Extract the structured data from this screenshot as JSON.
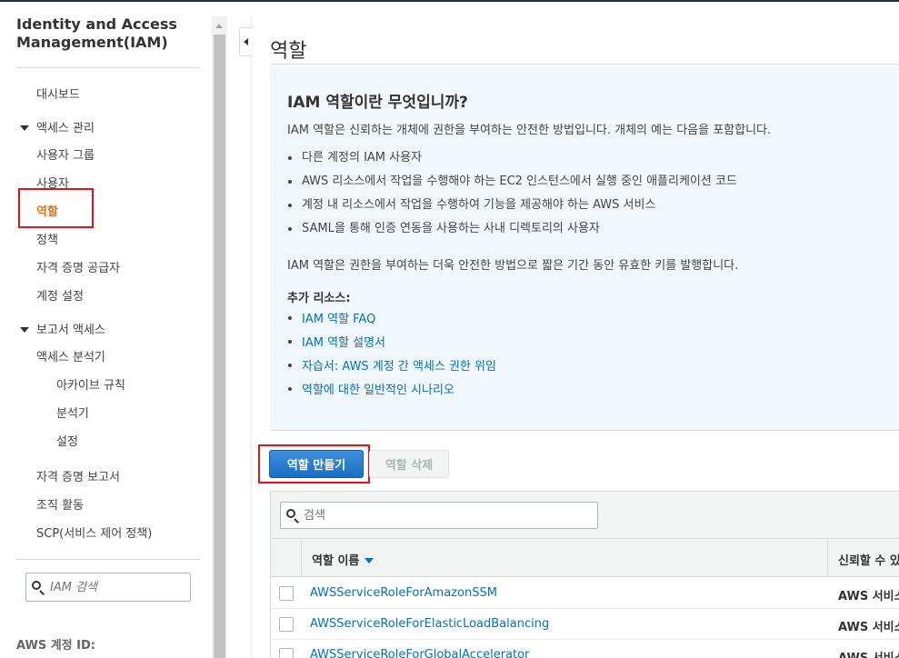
{
  "sidebar": {
    "title": "Identity and Access Management(IAM)",
    "dashboard": "대시보드",
    "access_management": {
      "label": "액세스 관리",
      "items": [
        "사용자 그룹",
        "사용자",
        "역할",
        "정책",
        "자격 증명 공급자",
        "계정 설정"
      ]
    },
    "access_reports": {
      "label": "보고서 액세스",
      "analyzer": "액세스 분석기",
      "analyzer_items": [
        "아카이브 규칙",
        "분석기",
        "설정"
      ],
      "items": [
        "자격 증명 보고서",
        "조직 활동",
        "SCP(서비스 제어 정책)"
      ]
    },
    "search_placeholder": "IAM 검색",
    "account_id_label": "AWS 계정 ID:",
    "active_item": "역할",
    "highlight_color": "#e0151c",
    "active_color": "#ec7211"
  },
  "main": {
    "title": "역할",
    "info": {
      "heading": "IAM 역할이란 무엇입니까?",
      "intro": "IAM 역할은 신뢰하는 개체에 권한을 부여하는 안전한 방법입니다. 개체의 예는 다음을 포함합니다.",
      "bullets": [
        "다른 계정의 IAM 사용자",
        "AWS 리소스에서 작업을 수행해야 하는 EC2 인스턴스에서 실행 중인 애플리케이션 코드",
        "계정 내 리소스에서 작업을 수행하여 기능을 제공해야 하는 AWS 서비스",
        "SAML을 통해 인증 연동을 사용하는 사내 디렉토리의 사용자"
      ],
      "summary": "IAM 역할은 권한을 부여하는 더욱 안전한 방법으로 짧은 기간 동안 유효한 키를 발행합니다.",
      "more_resources_label": "추가 리소스:",
      "links": [
        "IAM 역할 FAQ",
        "IAM 역할 설명서",
        "자습서: AWS 계정 간 액세스 권한 위임",
        "역할에 대한 일반적인 시나리오"
      ]
    },
    "buttons": {
      "create": "역할 만들기",
      "delete": "역할 삭제"
    },
    "table": {
      "search_placeholder": "검색",
      "columns": {
        "name": "역할 이름",
        "trusted": "신뢰할 수 있"
      },
      "rows": [
        {
          "name": "AWSServiceRoleForAmazonSSM",
          "trusted": "AWS 서비스"
        },
        {
          "name": "AWSServiceRoleForElasticLoadBalancing",
          "trusted": "AWS 서비스"
        },
        {
          "name": "AWSServiceRoleForGlobalAccelerator",
          "trusted": "AWS 서비스"
        }
      ]
    },
    "primary_color": "#1a6fc2",
    "link_color": "#0073bb",
    "info_bg": "#f1f8fd"
  }
}
